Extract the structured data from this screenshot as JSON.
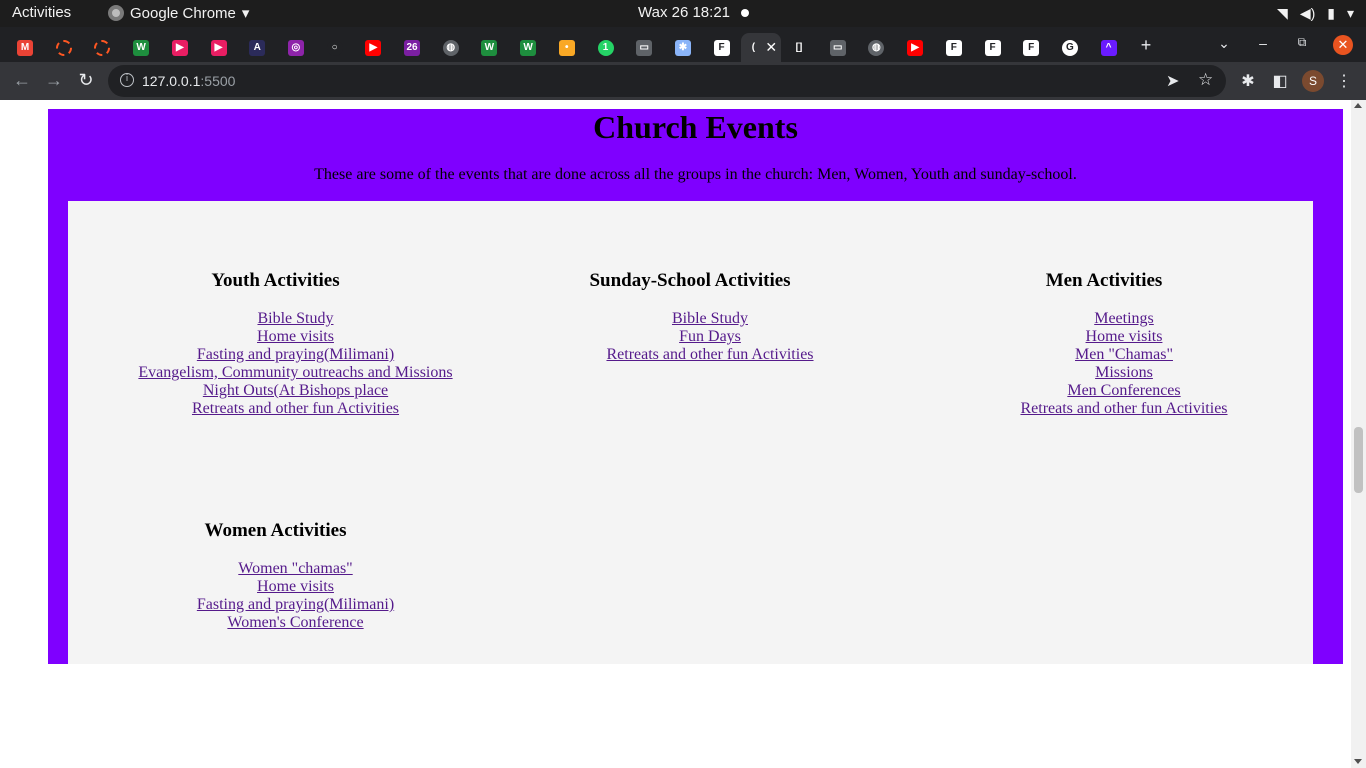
{
  "os_bar": {
    "activities": "Activities",
    "app_name": "Google Chrome",
    "clock": "Wax 26  18:21"
  },
  "browser": {
    "url_host": "127.0.0.1",
    "url_port": ":5500",
    "profile_initial": "S",
    "tabs": [
      {
        "icon": "gmail-icon",
        "glyph": "M",
        "color": "#ea4335"
      },
      {
        "icon": "ring-icon",
        "glyph": "",
        "color": "#ff5722"
      },
      {
        "icon": "ring-icon",
        "glyph": "",
        "color": "#ff5722"
      },
      {
        "icon": "w-icon",
        "glyph": "W",
        "color": "#1e8e3e"
      },
      {
        "icon": "play-icon",
        "glyph": "▶",
        "color": "#e91e63"
      },
      {
        "icon": "play-icon",
        "glyph": "▶",
        "color": "#e91e63"
      },
      {
        "icon": "a-icon",
        "glyph": "A",
        "color": "#2b2b5a"
      },
      {
        "icon": "colorwheel-icon",
        "glyph": "◎",
        "color": "#8e24aa"
      },
      {
        "icon": "github-icon",
        "glyph": "○",
        "color": "#202124"
      },
      {
        "icon": "youtube-icon",
        "glyph": "▶",
        "color": "#ff0000"
      },
      {
        "icon": "calendar-icon",
        "glyph": "26",
        "color": "#7b1fa2"
      },
      {
        "icon": "globe-icon",
        "glyph": "◍",
        "color": "#5f6368"
      },
      {
        "icon": "w-icon",
        "glyph": "W",
        "color": "#1e8e3e"
      },
      {
        "icon": "w-icon",
        "glyph": "W",
        "color": "#1e8e3e"
      },
      {
        "icon": "dots-icon",
        "glyph": "•",
        "color": "#f9a825"
      },
      {
        "icon": "whatsapp-icon",
        "glyph": "1",
        "color": "#25d366"
      },
      {
        "icon": "card-icon",
        "glyph": "▭",
        "color": "#5f6368"
      },
      {
        "icon": "puzzle-icon",
        "glyph": "✱",
        "color": "#8ab4f8"
      },
      {
        "icon": "f-icon",
        "glyph": "F",
        "color": "#ffffff"
      },
      {
        "icon": "loading-icon",
        "glyph": "(",
        "color": "#35363a"
      },
      {
        "icon": "bracket-icon",
        "glyph": "[]",
        "color": "#202124"
      },
      {
        "icon": "card-icon",
        "glyph": "▭",
        "color": "#5f6368"
      },
      {
        "icon": "globe-icon",
        "glyph": "◍",
        "color": "#5f6368"
      },
      {
        "icon": "youtube-icon",
        "glyph": "▶",
        "color": "#ff0000"
      },
      {
        "icon": "f-icon",
        "glyph": "F",
        "color": "#ffffff"
      },
      {
        "icon": "f-icon",
        "glyph": "F",
        "color": "#ffffff"
      },
      {
        "icon": "f-icon",
        "glyph": "F",
        "color": "#ffffff"
      },
      {
        "icon": "google-icon",
        "glyph": "G",
        "color": "#ffffff"
      },
      {
        "icon": "caret-icon",
        "glyph": "^",
        "color": "#6a1bff"
      }
    ]
  },
  "page": {
    "title": "Church Events",
    "intro": "These are some of the events that are done across all the groups in the church: Men, Women, Youth and sunday-school.",
    "colors": {
      "banner": "#7f00ff",
      "panel": "#f4f4f4",
      "link": "#551a8b"
    },
    "groups": {
      "youth": {
        "heading": "Youth Activities",
        "items": [
          "Bible Study",
          "Home visits",
          "Fasting and praying(Milimani)",
          "Evangelism, Community outreachs and Missions",
          "Night Outs(At Bishops place",
          "Retreats and other fun Activities"
        ]
      },
      "sunday": {
        "heading": "Sunday-School Activities",
        "items": [
          "Bible Study",
          "Fun Days",
          "Retreats and other fun Activities"
        ]
      },
      "men": {
        "heading": "Men Activities",
        "items": [
          "Meetings",
          "Home visits",
          "Men \"Chamas\"",
          "Missions",
          "Men Conferences",
          "Retreats and other fun Activities"
        ]
      },
      "women": {
        "heading": "Women Activities",
        "items": [
          "Women \"chamas\"",
          "Home visits",
          "Fasting and praying(Milimani)",
          "Women's Conference"
        ]
      }
    }
  }
}
